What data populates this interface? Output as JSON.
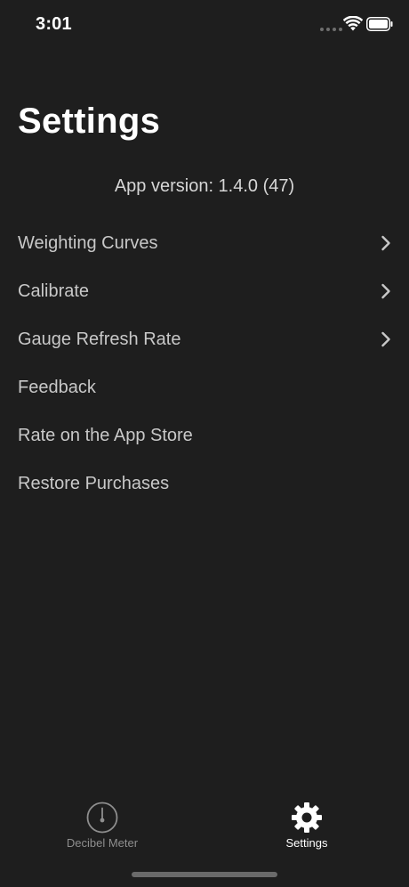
{
  "status_bar": {
    "time": "3:01"
  },
  "header": {
    "title": "Settings"
  },
  "app_version": "App version: 1.4.0 (47)",
  "settings": {
    "items": [
      {
        "label": "Weighting Curves",
        "has_chevron": true
      },
      {
        "label": "Calibrate",
        "has_chevron": true
      },
      {
        "label": "Gauge Refresh Rate",
        "has_chevron": true
      },
      {
        "label": "Feedback",
        "has_chevron": false
      },
      {
        "label": "Rate on the App Store",
        "has_chevron": false
      },
      {
        "label": "Restore Purchases",
        "has_chevron": false
      }
    ]
  },
  "tab_bar": {
    "tabs": [
      {
        "label": "Decibel Meter",
        "icon": "gauge-icon",
        "selected": false
      },
      {
        "label": "Settings",
        "icon": "gear-icon",
        "selected": true
      }
    ]
  },
  "colors": {
    "background": "#1e1e1e",
    "text_primary": "#ffffff",
    "text_secondary": "#c8c8c8",
    "tab_inactive": "#8e8e8e"
  }
}
